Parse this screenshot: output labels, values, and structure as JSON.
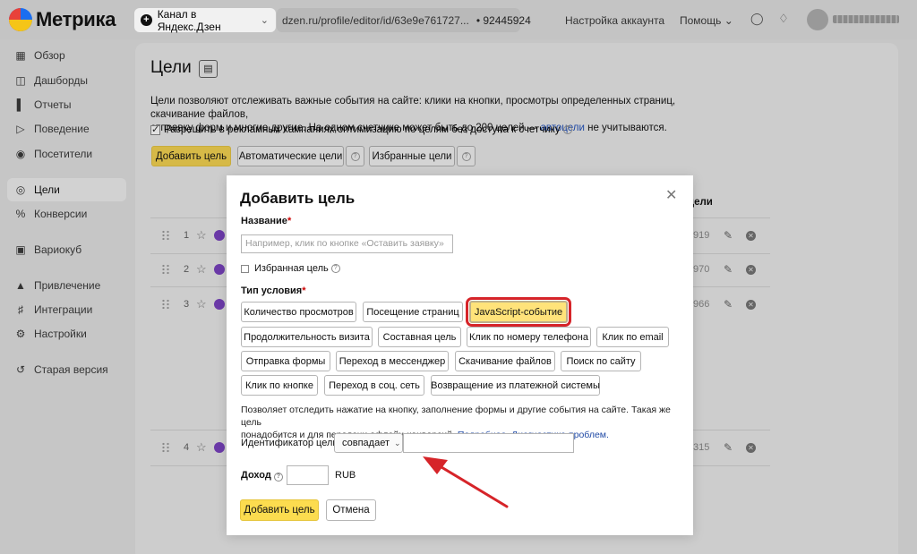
{
  "header": {
    "logo_text": "Метрика",
    "counter_name": "Канал в Яндекс.Дзен",
    "counter_url": "dzen.ru/profile/editor/id/63e9e761727...",
    "counter_id": "92445924",
    "account_settings": "Настройка аккаунта",
    "help": "Помощь"
  },
  "sidebar": {
    "items": [
      {
        "label": "Обзор",
        "icon": "grid-icon"
      },
      {
        "label": "Дашборды",
        "icon": "dashboard-icon"
      },
      {
        "label": "Отчеты",
        "icon": "reports-icon"
      },
      {
        "label": "Поведение",
        "icon": "play-icon"
      },
      {
        "label": "Посетители",
        "icon": "user-icon"
      },
      {
        "label": "Цели",
        "icon": "target-icon"
      },
      {
        "label": "Конверсии",
        "icon": "percent-icon"
      },
      {
        "label": "Вариокуб",
        "icon": "cube-icon"
      },
      {
        "label": "Привлечение",
        "icon": "fire-icon"
      },
      {
        "label": "Интеграции",
        "icon": "puzzle-icon"
      },
      {
        "label": "Настройки",
        "icon": "gear-icon"
      },
      {
        "label": "Старая версия",
        "icon": "undo-icon"
      }
    ],
    "active": "Цели"
  },
  "page": {
    "title": "Цели",
    "desc_line1": "Цели позволяют отслеживать важные события на сайте: клики на кнопки, просмотры определенных страниц, скачивание файлов,",
    "desc_line2_a": "отправку форм и многие другие. На одном счетчике может быть до 200 целей — ",
    "desc_link": "автоцели",
    "desc_line2_b": " не учитываются.",
    "allow_label": "Разрешить в рекламных кампаниях оптимизацию по целям без доступа к счетчику",
    "add_goal": "Добавить цель",
    "auto_goals": "Автоматические цели",
    "favorite_goals": "Избранные цели",
    "column_header": "цели",
    "rows": [
      {
        "num": "1",
        "tail": "919"
      },
      {
        "num": "2",
        "tail": "970"
      },
      {
        "num": "3",
        "tail": "966"
      },
      {
        "num": "4",
        "tail": "315"
      }
    ]
  },
  "modal": {
    "title": "Добавить цель",
    "name_label": "Название",
    "name_placeholder": "Например, клик по кнопке «Оставить заявку»",
    "favorite_label": "Избранная цель",
    "condition_label": "Тип условия",
    "conditions": [
      "Количество просмотров",
      "Посещение страниц",
      "JavaScript-событие",
      "Продолжительность визита",
      "Составная цель",
      "Клик по номеру телефона",
      "Клик по email",
      "Отправка формы",
      "Переход в мессенджер",
      "Скачивание файлов",
      "Поиск по сайту",
      "Клик по кнопке",
      "Переход в соц. сеть",
      "Возвращение из платежной системы"
    ],
    "selected_condition": "JavaScript-событие",
    "desc_line1": "Позволяет отследить нажатие на кнопку, заполнение формы и другие события на сайте. Такая же цель",
    "desc_line2": "понадобится и для передачи офлайн-конверсий. ",
    "link_more": "Подробнее.",
    "link_diag": "Диагностика проблем.",
    "identifier_label": "Идентификатор цели:",
    "match_value": "совпадает",
    "identifier_value": "",
    "revenue_label": "Доход",
    "revenue_value": "",
    "currency": "RUB",
    "submit": "Добавить цель",
    "cancel": "Отмена"
  },
  "colors": {
    "accent_yellow": "#fcdc4f",
    "highlight_red": "#d62429",
    "link_blue": "#1f49a5"
  }
}
